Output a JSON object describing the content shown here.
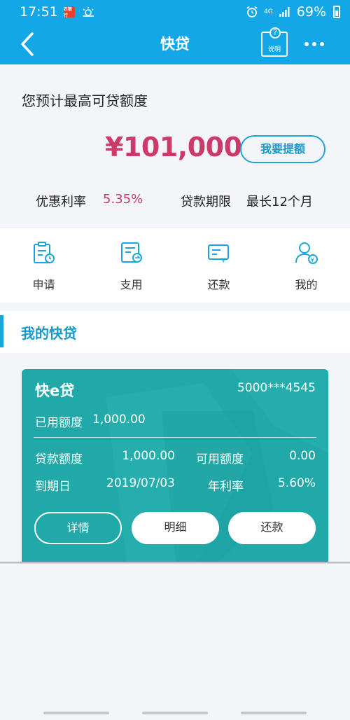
{
  "status_bar": {
    "time": "17:51",
    "network": "4G",
    "battery": "69%",
    "bank_badge": "农银行"
  },
  "header": {
    "title": "快贷",
    "help_label": "说明",
    "help_symbol": "?"
  },
  "summary": {
    "title": "您预计最高可贷额度",
    "amount": "¥101,000",
    "raise_button": "我要提额",
    "rate_label": "优惠利率",
    "rate_value": "5.35%",
    "term_label": "贷款期限",
    "term_value": "最长12个月"
  },
  "quick_menu": [
    {
      "label": "申请"
    },
    {
      "label": "支用"
    },
    {
      "label": "还款"
    },
    {
      "label": "我的"
    }
  ],
  "section": {
    "title": "我的快贷"
  },
  "card": {
    "name": "快e贷",
    "account": "5000***4545",
    "used_label": "已用额度",
    "used_value": "1,000.00",
    "loan_amount_label": "贷款额度",
    "loan_amount_value": "1,000.00",
    "available_label": "可用额度",
    "available_value": "0.00",
    "due_label": "到期日",
    "due_value": "2019/07/03",
    "annual_rate_label": "年利率",
    "annual_rate_value": "5.60%",
    "buttons": {
      "detail": "详情",
      "statement": "明细",
      "repay": "还款"
    }
  },
  "colors": {
    "brand_blue": "#14a7e8",
    "accent_red": "#cc3a6a",
    "card_teal": "#21a9a9"
  }
}
